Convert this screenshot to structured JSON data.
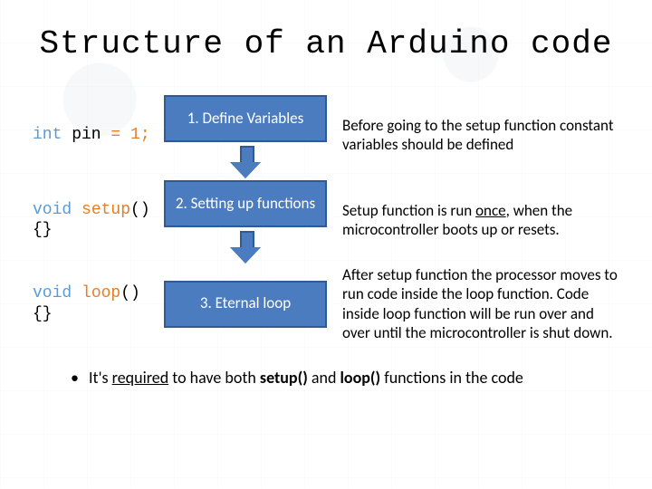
{
  "title": "Structure of an Arduino code",
  "rows": [
    {
      "code": {
        "type": "int",
        "ident": " pin",
        "assign": " = 1;",
        "line2": ""
      },
      "box": "1. Define Variables",
      "desc_html": "Before going to the setup function constant variables should be defined"
    },
    {
      "code": {
        "type": "void",
        "ident": " ",
        "func": "setup",
        "paren": "()",
        "line2": "{}"
      },
      "box": "2. Setting up functions",
      "desc_html": "Setup function is run <u>once</u>, when the microcontroller boots up or resets."
    },
    {
      "code": {
        "type": "void",
        "ident": " ",
        "func": "loop",
        "paren": "()",
        "line2": "{}"
      },
      "box": "3. Eternal loop",
      "desc_html": "After setup function the processor moves to run code inside the loop function. Code inside loop function will be run over and over until the microcontroller is shut down."
    }
  ],
  "bullet_html": "It's <u>required</u> to have both <b>setup()</b> and <b>loop()</b> functions in the code"
}
